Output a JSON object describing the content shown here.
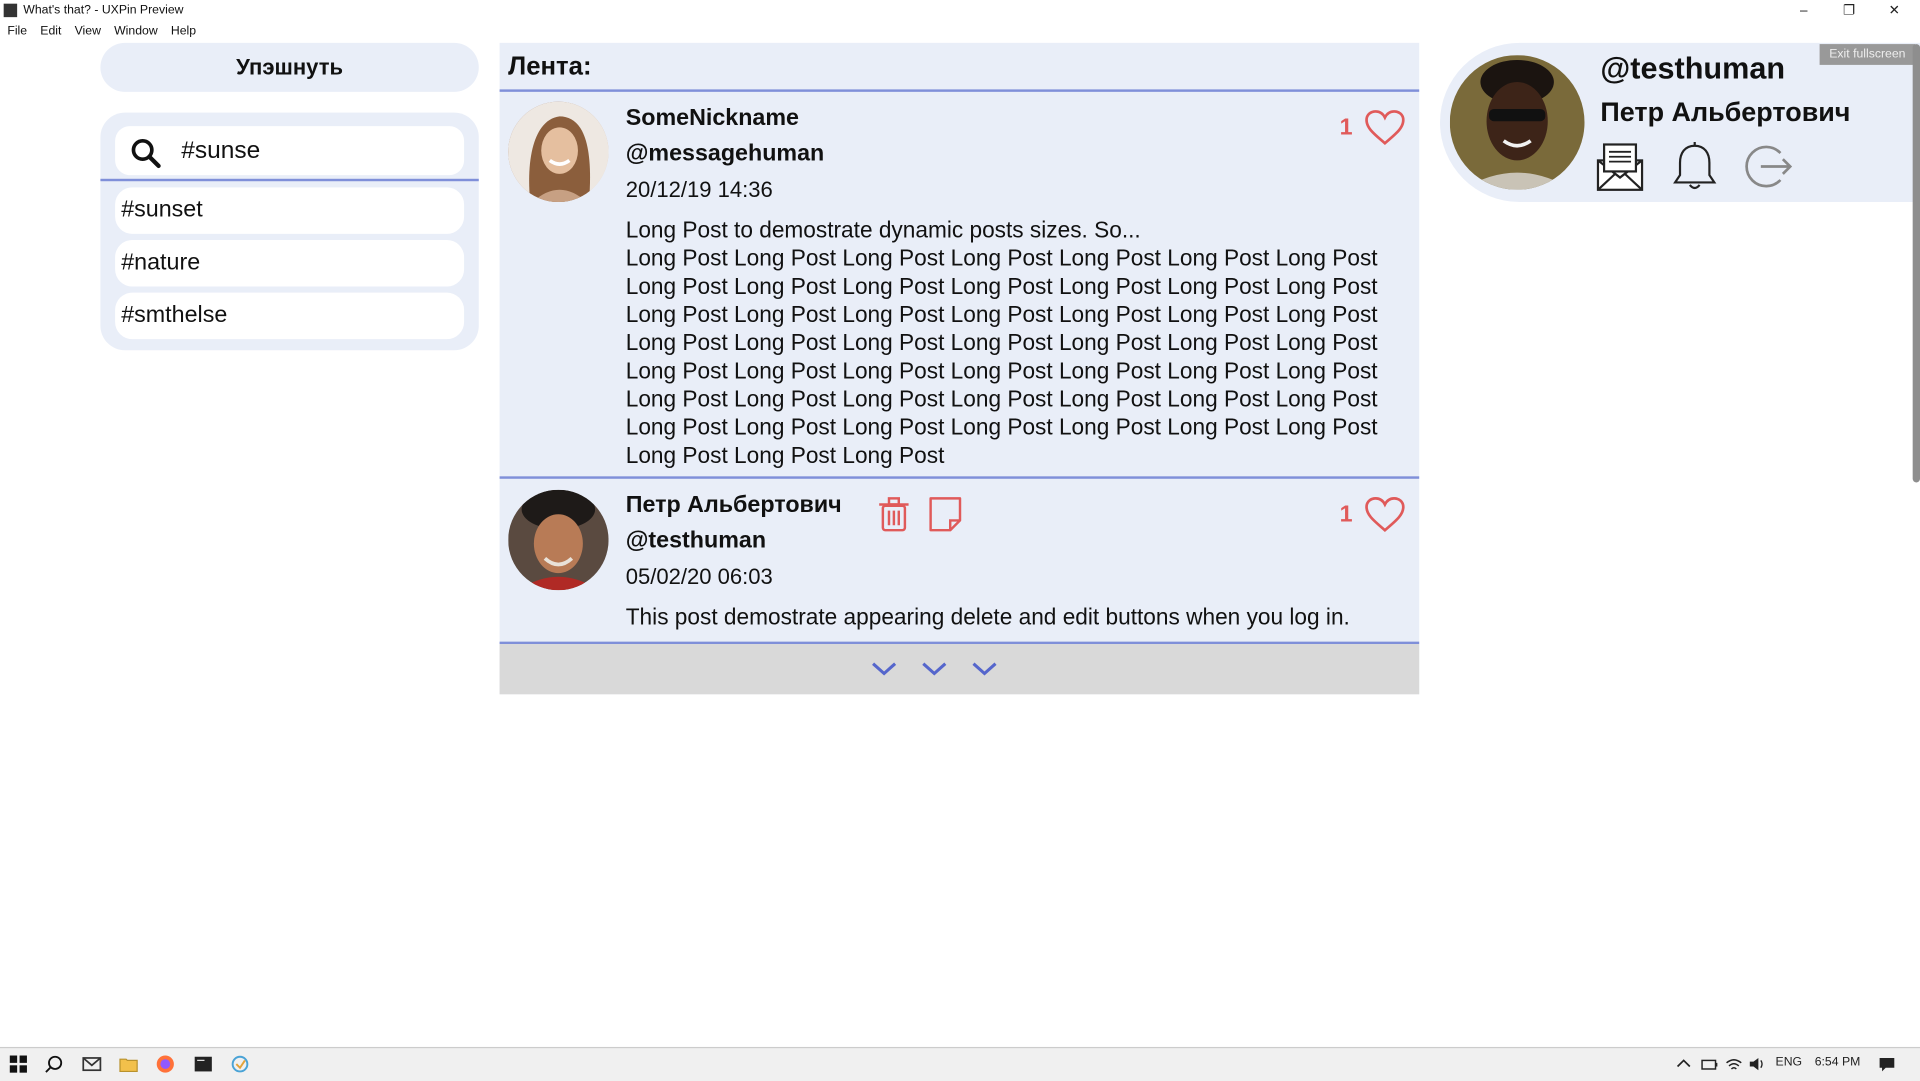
{
  "window": {
    "title": "What's that? - UXPin Preview",
    "minimize": "–",
    "restore": "❐",
    "close": "✕",
    "exit_fullscreen": "Exit fullscreen"
  },
  "menu": [
    "File",
    "Edit",
    "View",
    "Window",
    "Help"
  ],
  "left": {
    "action_button": "Упэшнуть",
    "search_value": "#sunse",
    "suggestions": [
      "#sunset",
      "#nature",
      "#smthelse"
    ]
  },
  "feed": {
    "title": "Лента:",
    "posts": [
      {
        "name": "SomeNickname",
        "handle": "@messagehuman",
        "date": "20/12/19 14:36",
        "likes": "1",
        "text": "Long Post to demostrate dynamic posts sizes. So...\nLong Post Long Post Long Post Long Post Long Post Long Post Long Post Long Post Long Post Long Post Long Post Long Post Long Post Long Post Long Post Long Post Long Post Long Post Long Post Long Post Long Post Long Post Long Post Long Post Long Post Long Post Long Post Long Post Long Post Long Post Long Post Long Post Long Post Long Post Long Post Long Post Long Post Long Post Long Post Long Post Long Post Long Post Long Post Long Post Long Post Long Post Long Post Long Post Long Post Long Post Long Post Long Post"
      },
      {
        "name": "Петр Альбертович",
        "handle": "@testhuman",
        "date": "05/02/20 06:03",
        "likes": "1",
        "text": "This post demostrate appearing delete and edit buttons when you log in."
      }
    ]
  },
  "profile": {
    "handle": "@testhuman",
    "name": "Петр Альбертович"
  },
  "taskbar": {
    "lang": "ENG",
    "time": "6:54 PM"
  },
  "colors": {
    "panel": "#e9eef8",
    "accent_line": "#7f8fd9",
    "like": "#e05a5a",
    "load_more": "#d9d9d9"
  }
}
